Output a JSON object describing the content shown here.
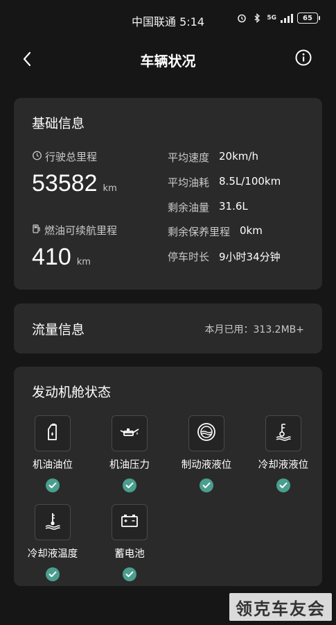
{
  "status_bar": {
    "carrier_time": "中国联通 5:14",
    "network": "5G",
    "battery": "65"
  },
  "header": {
    "title": "车辆状况",
    "back_icon": "chevron-left-icon",
    "info_icon": "info-circle-icon"
  },
  "basic_info": {
    "title": "基础信息",
    "total_mileage_label": "行驶总里程",
    "total_mileage_value": "53582",
    "total_mileage_unit": "km",
    "range_label": "燃油可续航里程",
    "range_value": "410",
    "range_unit": "km",
    "details": [
      {
        "label": "平均速度",
        "value": "20km/h"
      },
      {
        "label": "平均油耗",
        "value": "8.5L/100km"
      },
      {
        "label": "剩余油量",
        "value": "31.6L"
      },
      {
        "label": "剩余保养里程",
        "value": "0km"
      },
      {
        "label": "停车时长",
        "value": "9小时34分钟"
      }
    ]
  },
  "traffic": {
    "title": "流量信息",
    "used": "本月已用：313.2MB+"
  },
  "engine": {
    "title": "发动机舱状态",
    "items": [
      {
        "label": "机油油位",
        "icon": "oil-can-icon",
        "ok": true
      },
      {
        "label": "机油压力",
        "icon": "oil-pressure-icon",
        "ok": true
      },
      {
        "label": "制动液液位",
        "icon": "brake-fluid-icon",
        "ok": true
      },
      {
        "label": "冷却液液位",
        "icon": "coolant-level-icon",
        "ok": true
      },
      {
        "label": "冷却液温度",
        "icon": "coolant-temperature-icon",
        "ok": true
      },
      {
        "label": "蓄电池",
        "icon": "battery-icon",
        "ok": true
      }
    ]
  },
  "watermark": "领克车友会",
  "colors": {
    "background": "#161616",
    "card": "#2a2a2a",
    "check": "#4a9e8e"
  }
}
